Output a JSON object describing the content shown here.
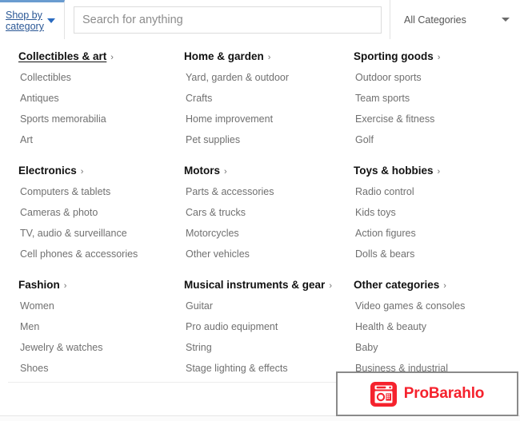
{
  "header": {
    "shop_by_category": {
      "label": "Shop by\ncategory",
      "caret_icon": "chevron-down-icon"
    },
    "search": {
      "placeholder": "Search for anything",
      "value": ""
    },
    "category_select": {
      "selected": "All Categories",
      "caret_icon": "chevron-down-icon"
    },
    "accent_color": "#2a5795",
    "tab_border_color": "#6a9cd0"
  },
  "categories": [
    {
      "title": "Collectibles & art",
      "chevron": "›",
      "hovered": true,
      "items": [
        "Collectibles",
        "Antiques",
        "Sports memorabilia",
        "Art"
      ]
    },
    {
      "title": "Home & garden",
      "chevron": "›",
      "hovered": false,
      "items": [
        "Yard, garden & outdoor",
        "Crafts",
        "Home improvement",
        "Pet supplies"
      ]
    },
    {
      "title": "Sporting goods",
      "chevron": "›",
      "hovered": false,
      "items": [
        "Outdoor sports",
        "Team sports",
        "Exercise & fitness",
        "Golf"
      ]
    },
    {
      "title": "Electronics",
      "chevron": "›",
      "hovered": false,
      "items": [
        "Computers & tablets",
        "Cameras & photo",
        "TV, audio & surveillance",
        "Cell phones & accessories"
      ]
    },
    {
      "title": "Motors",
      "chevron": "›",
      "hovered": false,
      "items": [
        "Parts & accessories",
        "Cars & trucks",
        "Motorcycles",
        "Other vehicles"
      ]
    },
    {
      "title": "Toys & hobbies",
      "chevron": "›",
      "hovered": false,
      "items": [
        "Radio control",
        "Kids toys",
        "Action figures",
        "Dolls & bears"
      ]
    },
    {
      "title": "Fashion",
      "chevron": "›",
      "hovered": false,
      "items": [
        "Women",
        "Men",
        "Jewelry & watches",
        "Shoes"
      ]
    },
    {
      "title": "Musical instruments & gear",
      "chevron": "›",
      "hovered": false,
      "items": [
        "Guitar",
        "Pro audio equipment",
        "String",
        "Stage lighting & effects"
      ]
    },
    {
      "title": "Other categories",
      "chevron": "›",
      "hovered": false,
      "items": [
        "Video games & consoles",
        "Health & beauty",
        "Baby",
        "Business & industrial"
      ]
    }
  ],
  "watermark": {
    "brand": "ProBarahlo",
    "icon": "camera-badge-icon",
    "brand_color": "#f5222d",
    "box_border_color": "#8a8a8a"
  }
}
